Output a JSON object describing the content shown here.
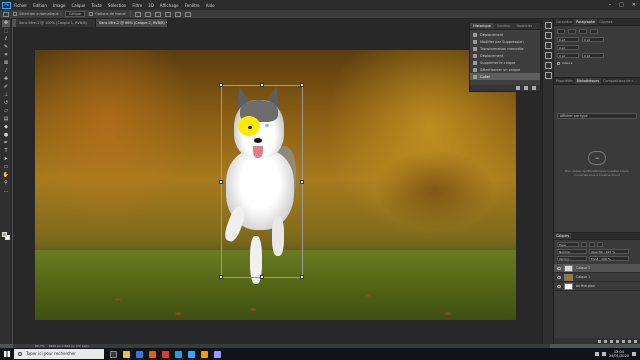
{
  "menubar": {
    "logo": "Ps",
    "items": [
      "Fichier",
      "Edition",
      "Image",
      "Calque",
      "Texte",
      "Sélection",
      "Filtre",
      "3D",
      "Affichage",
      "Fenêtre",
      "Aide"
    ],
    "window_controls": [
      "–",
      "□",
      "✕"
    ]
  },
  "options": {
    "auto_select_label": "Sélection automatique :",
    "auto_select_value": "Calque",
    "show_transform_label": "Options de transf."
  },
  "tabs": [
    {
      "label": "Sans titre-1 @ 100% (Calque 1, RVB/8)",
      "active": false
    },
    {
      "label": "Sans titre-2 @ 66% (Calque 2, RVB/8) *",
      "active": true
    }
  ],
  "history": {
    "tabs": [
      "Historique",
      "Couleur",
      "Nuancier"
    ],
    "items": [
      "Déplacement",
      "Modifier par Suppression",
      "Transformation manuelle",
      "Déplacement",
      "Supprimer le calque",
      "Sélectionner un calque",
      "Coller"
    ],
    "active_index": 6
  },
  "character": {
    "tabs": [
      "Caractère",
      "Paragraphe",
      "Glyphes"
    ],
    "fields": [
      "0 pt",
      "0 pt",
      "0 pt",
      "0 pt",
      "0 pt"
    ],
    "checkbox_label": "Césure"
  },
  "libraries": {
    "tabs": [
      "Propriétés",
      "Bibliothèques",
      "Compositions de c..."
    ],
    "dropdown": "Afficher par type",
    "cloud_icon": "cloud-icon",
    "message": "Pour utiliser les Bibliothèques Creative Cloud, connectez-vous à Creative Cloud."
  },
  "layers": {
    "tabs": [
      "Calques"
    ],
    "kind_filter": "Type",
    "blend_mode": "Normal",
    "opacity": "Opacité : 100 %",
    "lock_label": "Verrou :",
    "fill": "Fond : 100 %",
    "items": [
      {
        "name": "Calque 2",
        "active": true
      },
      {
        "name": "Calque 1",
        "active": false
      },
      {
        "name": "Arrière-plan",
        "active": false
      }
    ]
  },
  "status": {
    "zoom": "66,7%",
    "doc_size": "1500 px x 844 px (72 ppp)"
  },
  "taskbar": {
    "search_placeholder": "Taper ici pour rechercher",
    "time": "12:04",
    "date": "24/01/2020"
  },
  "colors": {
    "foreground_swatch": "#8ac34a",
    "background_swatch": "#ffffff",
    "brush_spot": "#ffea00"
  }
}
